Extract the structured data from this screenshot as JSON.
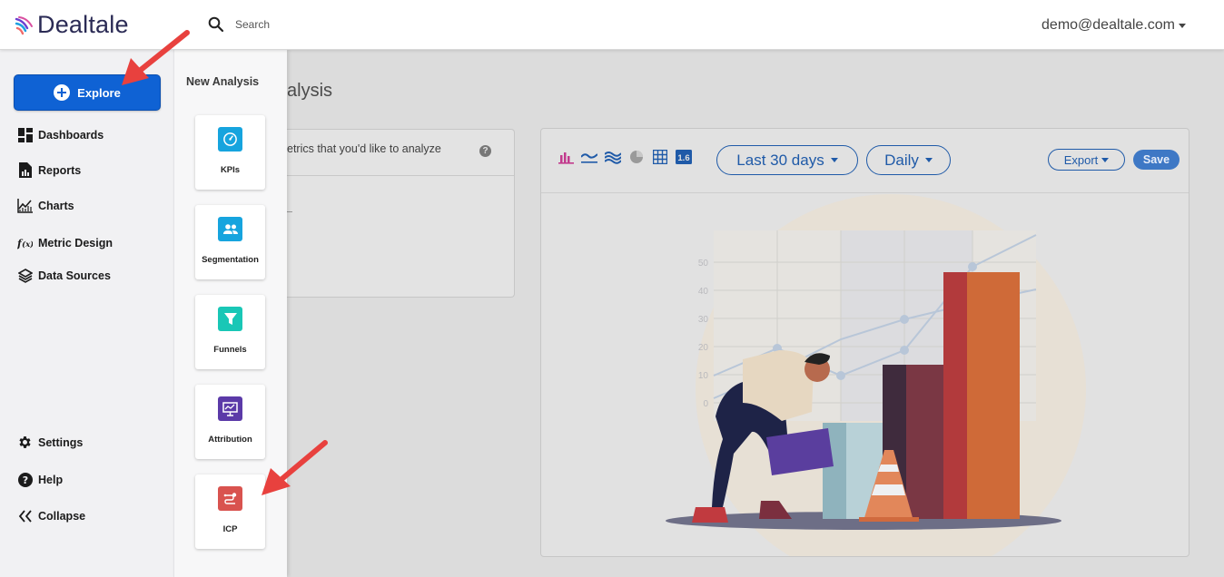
{
  "header": {
    "brand": "Dealtale",
    "search_placeholder": "Search",
    "user_email": "demo@dealtale.com"
  },
  "sidebar": {
    "explore_label": "Explore",
    "items": [
      {
        "label": "Dashboards",
        "icon": "dashboard-grid-icon"
      },
      {
        "label": "Reports",
        "icon": "report-doc-icon"
      },
      {
        "label": "Charts",
        "icon": "line-chart-icon"
      },
      {
        "label": "Metric Design",
        "icon": "function-fx-icon"
      },
      {
        "label": "Data Sources",
        "icon": "layers-icon"
      }
    ],
    "bottom_items": [
      {
        "label": "Settings",
        "icon": "gear-icon"
      },
      {
        "label": "Help",
        "icon": "question-circle-icon"
      },
      {
        "label": "Collapse",
        "icon": "double-chevron-left-icon"
      }
    ]
  },
  "flyout": {
    "title": "New Analysis",
    "cards": [
      {
        "label": "KPIs",
        "icon": "gauge-icon",
        "color": "#16a4de"
      },
      {
        "label": "Segmentation",
        "icon": "users-icon",
        "color": "#16a4de"
      },
      {
        "label": "Funnels",
        "icon": "funnel-icon",
        "color": "#19c7b6"
      },
      {
        "label": "Attribution",
        "icon": "presentation-chart-icon",
        "color": "#5b3aa8"
      },
      {
        "label": "ICP",
        "icon": "route-pin-icon",
        "color": "#d9534f"
      }
    ]
  },
  "main": {
    "title_partial": "alysis",
    "left_panel_text": "etrics that you'd like to analyze",
    "help_glyph": "?",
    "chart_toolbar": {
      "viz_icons": [
        "bar-chart-icon",
        "line-icon",
        "area-icon",
        "pie-icon",
        "table-icon",
        "number-1-6-icon"
      ],
      "number_icon_text": "1.6",
      "date_range": "Last 30 days",
      "granularity": "Daily",
      "export_label": "Export",
      "save_label": "Save"
    },
    "illustration_ticks": [
      "50",
      "40",
      "30",
      "20",
      "10",
      "0"
    ]
  },
  "colors": {
    "brand_blue": "#0f62d4",
    "accent_outline": "#1f5aa8",
    "annotation_arrow": "#e8413e"
  }
}
